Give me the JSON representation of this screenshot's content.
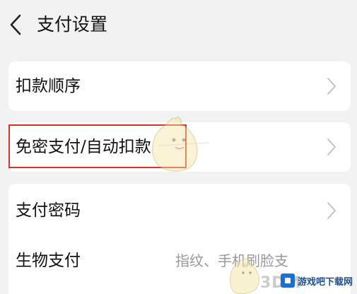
{
  "header": {
    "back_icon": "chevron-left-icon",
    "title": "支付设置"
  },
  "rows": [
    {
      "label": "扣款顺序",
      "chevron": true
    },
    {
      "label": "免密支付/自动扣款",
      "chevron": true,
      "highlighted": true
    },
    {
      "label": "支付密码",
      "chevron": true
    },
    {
      "label": "生物支付",
      "value": "指纹、手机刷脸支"
    }
  ],
  "watermark": {
    "site_text": "游戏吧下载网",
    "brand_text": "3DM"
  },
  "colors": {
    "page_background": "#f2f2f2",
    "card_background": "#ffffff",
    "highlight_border": "#d9342b",
    "secondary_text": "#9a9a9a",
    "chevron": "#c4c4c4"
  }
}
